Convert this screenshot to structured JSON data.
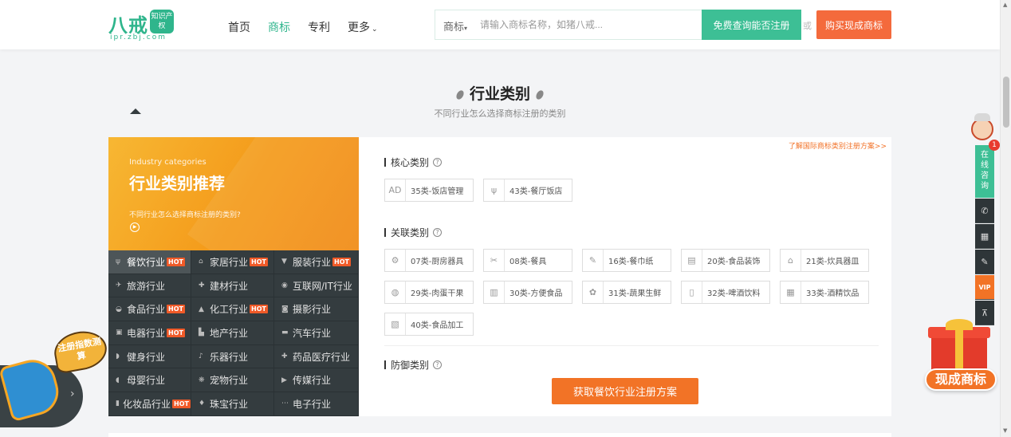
{
  "header": {
    "logo_main": "八戒",
    "logo_badge": "知识产权",
    "logo_sub": "ipr.zbj.com",
    "nav": [
      "首页",
      "商标",
      "专利",
      "更多"
    ],
    "search_type": "商标",
    "search_placeholder": "请输入商标名称，如猪八戒...",
    "search_button": "免费查询能否注册",
    "or_text": "或",
    "buy_button": "购买现成商标"
  },
  "section": {
    "title": "行业类别",
    "subtitle": "不同行业怎么选择商标注册的类别"
  },
  "promo": {
    "en_label": "Industry categories",
    "title": "行业类别推荐",
    "desc": "不同行业怎么选择商标注册的类别?"
  },
  "industries": [
    {
      "label": "餐饮行业",
      "hot": true,
      "icon": "fork-icon",
      "glyph": "ψ"
    },
    {
      "label": "家居行业",
      "hot": true,
      "icon": "home-icon",
      "glyph": "⌂"
    },
    {
      "label": "服装行业",
      "hot": true,
      "icon": "shirt-icon",
      "glyph": "▼"
    },
    {
      "label": "旅游行业",
      "hot": false,
      "icon": "plane-icon",
      "glyph": "✈"
    },
    {
      "label": "建材行业",
      "hot": false,
      "icon": "tools-icon",
      "glyph": "✚"
    },
    {
      "label": "互联网/IT行业",
      "hot": false,
      "icon": "globe-icon",
      "glyph": "◉"
    },
    {
      "label": "食品行业",
      "hot": true,
      "icon": "food-icon",
      "glyph": "◒"
    },
    {
      "label": "化工行业",
      "hot": true,
      "icon": "flask-icon",
      "glyph": "▲"
    },
    {
      "label": "摄影行业",
      "hot": false,
      "icon": "camera-icon",
      "glyph": "◙"
    },
    {
      "label": "电器行业",
      "hot": true,
      "icon": "appliance-icon",
      "glyph": "▣"
    },
    {
      "label": "地产行业",
      "hot": false,
      "icon": "building-icon",
      "glyph": "▙"
    },
    {
      "label": "汽车行业",
      "hot": false,
      "icon": "car-icon",
      "glyph": "▬"
    },
    {
      "label": "健身行业",
      "hot": false,
      "icon": "fitness-icon",
      "glyph": "◗"
    },
    {
      "label": "乐器行业",
      "hot": false,
      "icon": "music-icon",
      "glyph": "♪"
    },
    {
      "label": "药品医疗行业",
      "hot": false,
      "icon": "medical-icon",
      "glyph": "✚"
    },
    {
      "label": "母婴行业",
      "hot": false,
      "icon": "baby-icon",
      "glyph": "◖"
    },
    {
      "label": "宠物行业",
      "hot": false,
      "icon": "paw-icon",
      "glyph": "❋"
    },
    {
      "label": "传媒行业",
      "hot": false,
      "icon": "media-icon",
      "glyph": "▶"
    },
    {
      "label": "化妆品行业",
      "hot": true,
      "icon": "cosmetics-icon",
      "glyph": "▮"
    },
    {
      "label": "珠宝行业",
      "hot": false,
      "icon": "diamond-icon",
      "glyph": "♦"
    },
    {
      "label": "电子行业",
      "hot": false,
      "icon": "chip-icon",
      "glyph": "⋯"
    }
  ],
  "hot_label": "HOT",
  "content": {
    "intl_link": "了解国际商标类别注册方案>>",
    "core_title": "核心类别",
    "core": [
      {
        "label": "35类-饭店管理",
        "icon": "ad-icon",
        "glyph": "AD"
      },
      {
        "label": "43类-餐厅饭店",
        "icon": "cutlery-icon",
        "glyph": "ψ"
      }
    ],
    "related_title": "关联类别",
    "related": [
      {
        "label": "07类-厨房器具",
        "icon": "gear-icon",
        "glyph": "⚙"
      },
      {
        "label": "08类-餐具",
        "icon": "scissors-icon",
        "glyph": "✂"
      },
      {
        "label": "16类-餐巾纸",
        "icon": "pen-icon",
        "glyph": "✎"
      },
      {
        "label": "20类-食品装饰",
        "icon": "cabinet-icon",
        "glyph": "▤"
      },
      {
        "label": "21类-炊具器皿",
        "icon": "cup-icon",
        "glyph": "⌂"
      },
      {
        "label": "29类-肉蛋干果",
        "icon": "egg-icon",
        "glyph": "◍"
      },
      {
        "label": "30类-方便食品",
        "icon": "noodle-icon",
        "glyph": "▥"
      },
      {
        "label": "31类-蔬果生鲜",
        "icon": "plant-icon",
        "glyph": "✿"
      },
      {
        "label": "32类-啤酒饮料",
        "icon": "beer-icon",
        "glyph": "▯"
      },
      {
        "label": "33类-酒精饮品",
        "icon": "wine-icon",
        "glyph": "▦"
      },
      {
        "label": "40类-食品加工",
        "icon": "process-icon",
        "glyph": "▧"
      }
    ],
    "defense_title": "防御类别",
    "get_plan_button": "获取餐饮行业注册方案"
  },
  "float_bar": {
    "consult": "在线咨询",
    "badge": "1",
    "vip": "VIP"
  },
  "gift_label": "现成商标",
  "mega_text": "注册指数测算",
  "colors": {
    "brand_green": "#2fb58c",
    "accent_orange": "#f27326",
    "dark_panel": "#343c3f"
  }
}
